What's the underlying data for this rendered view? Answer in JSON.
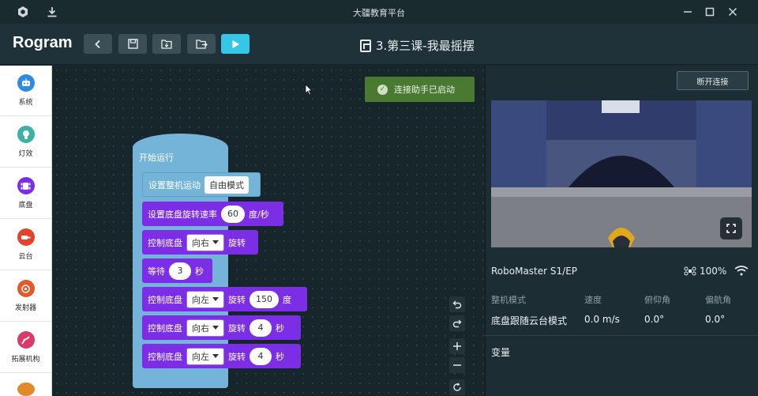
{
  "window": {
    "title": "大疆教育平台"
  },
  "toolbar": {
    "brand": "Rogram",
    "doc_title": "3.第三课-我最摇摆"
  },
  "sidebar": {
    "items": [
      {
        "label": "系统",
        "color": "#2e8be0"
      },
      {
        "label": "灯效",
        "color": "#3bb3a4"
      },
      {
        "label": "底盘",
        "color": "#7b2ee6"
      },
      {
        "label": "云台",
        "color": "#e0442a"
      },
      {
        "label": "发射器",
        "color": "#e05a2a"
      },
      {
        "label": "拓展机构",
        "color": "#d83a6a"
      }
    ]
  },
  "workspace": {
    "toast": "连接助手已启动",
    "hat_label": "开始运行",
    "blocks": {
      "b1": {
        "label": "设置整机运动",
        "field": "自由模式"
      },
      "b2": {
        "label": "设置底盘旋转速率",
        "value": "60",
        "unit": "度/秒"
      },
      "b3": {
        "label": "控制底盘",
        "dir": "向右",
        "action": "旋转"
      },
      "b4": {
        "label": "等待",
        "value": "3",
        "unit": "秒"
      },
      "b5": {
        "label": "控制底盘",
        "dir": "向左",
        "action": "旋转",
        "value": "150",
        "unit": "度"
      },
      "b6": {
        "label": "控制底盘",
        "dir": "向右",
        "action": "旋转",
        "value": "4",
        "unit": "秒"
      },
      "b7": {
        "label": "控制底盘",
        "dir": "向左",
        "action": "旋转",
        "value": "4",
        "unit": "秒"
      }
    }
  },
  "panel": {
    "disconnect": "断开连接",
    "robot_name": "RoboMaster S1/EP",
    "battery": "100%",
    "stats": {
      "mode_label": "整机模式",
      "mode_value": "底盘跟随云台模式",
      "speed_label": "速度",
      "speed_value": "0.0 m/s",
      "pitch_label": "俯仰角",
      "pitch_value": "0.0°",
      "yaw_label": "偏航角",
      "yaw_value": "0.0°"
    },
    "variables_title": "变量"
  }
}
